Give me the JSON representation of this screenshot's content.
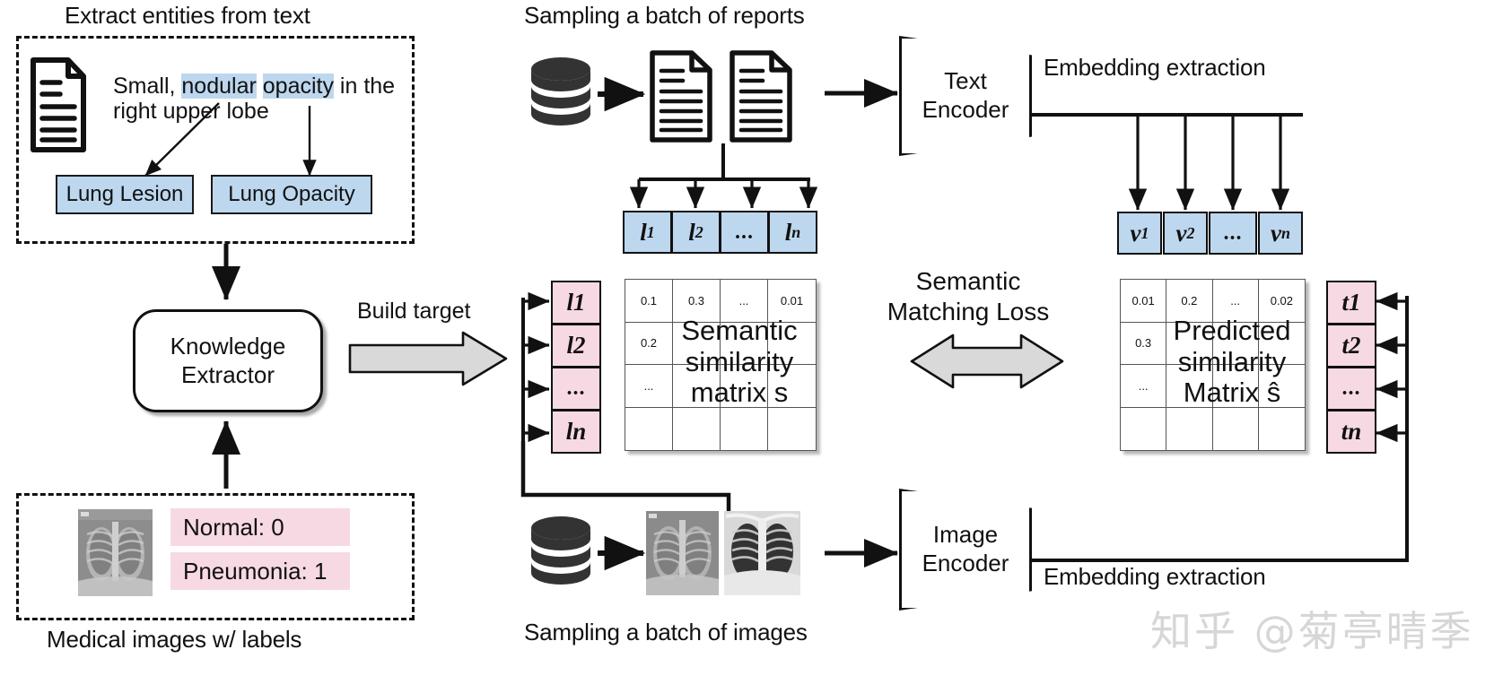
{
  "figure": {
    "title_extract": "Extract entities from text",
    "title_reports": "Sampling a batch of reports",
    "title_images": "Sampling a batch of images",
    "caption_medical": "Medical images w/ labels",
    "watermark": "知乎 @菊亭晴季"
  },
  "extract_panel": {
    "sentence_parts": [
      {
        "text": "Small, ",
        "highlight": false
      },
      {
        "text": "nodular",
        "highlight": true
      },
      {
        "text": " ",
        "highlight": false
      },
      {
        "text": "opacity",
        "highlight": true
      },
      {
        "text": " in the",
        "highlight": false
      }
    ],
    "sentence_line1": "Small, nodular opacity in the",
    "sentence_line2": "right upper lobe",
    "entities": [
      "Lung Lesion",
      "Lung Opacity"
    ],
    "doc_icon": "document-icon"
  },
  "knowledge_extractor": {
    "line1": "Knowledge",
    "line2": "Extractor",
    "build_target_label": "Build target"
  },
  "medical_panel": {
    "labels": [
      "Normal: 0",
      "Pneumonia: 1"
    ],
    "image_alt": "chest-xray-thumbnail"
  },
  "reports_branch": {
    "db_icon": "database-icon",
    "doc_icons": [
      "document-icon",
      "document-icon"
    ],
    "label_vector": [
      "l₁",
      "l₂",
      "...",
      "lₙ"
    ],
    "label_vector_plain": [
      {
        "base": "l",
        "sub": "1"
      },
      {
        "base": "l",
        "sub": "2"
      },
      {
        "base": "...",
        "sub": ""
      },
      {
        "base": "l",
        "sub": "n"
      }
    ]
  },
  "text_encoder": {
    "line1": "Text",
    "line2": "Encoder",
    "embedding_label": "Embedding extraction",
    "v_vector": [
      {
        "base": "v",
        "sub": "1"
      },
      {
        "base": "v",
        "sub": "2"
      },
      {
        "base": "...",
        "sub": ""
      },
      {
        "base": "v",
        "sub": "n"
      }
    ]
  },
  "image_encoder": {
    "line1": "Image",
    "line2": "Encoder",
    "embedding_label": "Embedding extraction",
    "t_vector": [
      {
        "base": "t",
        "sub": "1"
      },
      {
        "base": "t",
        "sub": "2"
      },
      {
        "base": "...",
        "sub": ""
      },
      {
        "base": "t",
        "sub": "n"
      }
    ]
  },
  "images_branch": {
    "db_icon": "database-icon",
    "xray_icons": [
      "chest-xray-1",
      "chest-xray-2"
    ]
  },
  "target_side": {
    "l_vector": [
      {
        "base": "l",
        "sub": "1"
      },
      {
        "base": "l",
        "sub": "2"
      },
      {
        "base": "...",
        "sub": ""
      },
      {
        "base": "l",
        "sub": "n"
      }
    ]
  },
  "loss": {
    "line1": "Semantic",
    "line2": "Matching Loss"
  },
  "chart_data": {
    "type": "table",
    "title": "Semantic similarity matrix s vs Predicted similarity matrix ŝ",
    "matrices": [
      {
        "name": "semantic_similarity_matrix",
        "caption_lines": [
          "Semantic",
          "similarity",
          "matrix s"
        ],
        "row_headers": [
          "l₁",
          "l₂",
          "...",
          "lₙ"
        ],
        "col_headers": [
          "",
          "",
          "",
          ""
        ],
        "cells": [
          [
            "0.1",
            "0.3",
            "...",
            "0.01"
          ],
          [
            "0.2",
            "",
            "",
            ""
          ],
          [
            "...",
            "",
            "",
            ""
          ],
          [
            "",
            "",
            "",
            ""
          ]
        ]
      },
      {
        "name": "predicted_similarity_matrix",
        "caption_lines": [
          "Predicted",
          "similarity",
          "Matrix ŝ"
        ],
        "row_headers": [
          "t₁",
          "t₂",
          "...",
          "tₙ"
        ],
        "col_headers": [
          "",
          "",
          "",
          ""
        ],
        "cells": [
          [
            "0.01",
            "0.2",
            "...",
            "0.02"
          ],
          [
            "0.3",
            "",
            "",
            ""
          ],
          [
            "...",
            "",
            "",
            ""
          ],
          [
            "",
            "",
            "",
            ""
          ]
        ]
      }
    ]
  },
  "colors": {
    "blue_fill": "#bdd7ee",
    "pink_fill": "#f7d9e3",
    "stroke": "#111111",
    "grey_arrow_fill": "#d9d9d9",
    "matrix_grid": "#555555",
    "watermark": "#d6d6d6"
  }
}
